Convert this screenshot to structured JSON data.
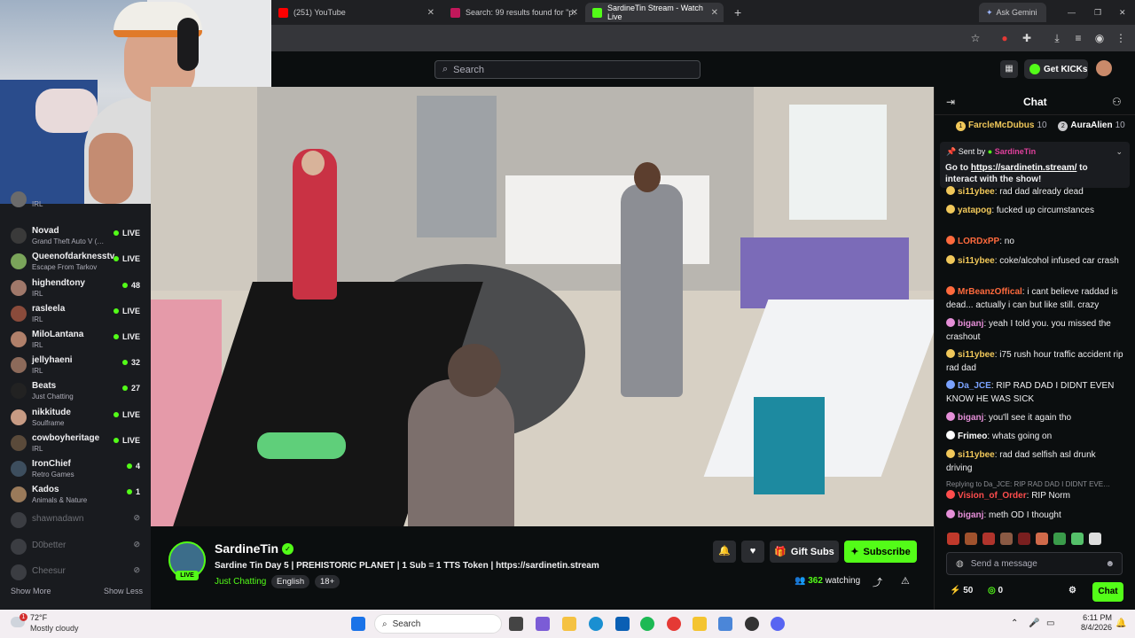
{
  "browser": {
    "tabs": [
      {
        "label": "(251) YouTube",
        "color": "#ff0000"
      },
      {
        "label": "Search: 99 results found for \"p…",
        "color": "#c2185b"
      },
      {
        "label": "SardineTin Stream - Watch Live",
        "color": "#53fc18"
      }
    ],
    "new_tab": "+",
    "ask_gemini": "Ask Gemini"
  },
  "site": {
    "search_placeholder": "Search",
    "get_kicks": "Get KICKs"
  },
  "sidebar": {
    "items": [
      {
        "name": "",
        "category": "IRL",
        "status": "",
        "live": false,
        "offline": false,
        "partial": true
      },
      {
        "name": "Novad",
        "category": "Grand Theft Auto V (…",
        "status": "LIVE",
        "live": true
      },
      {
        "name": "Queenofdarknesstv",
        "category": "Escape From Tarkov",
        "status": "LIVE",
        "live": true
      },
      {
        "name": "highendtony",
        "category": "IRL",
        "status": "48",
        "live": true
      },
      {
        "name": "rasleela",
        "category": "IRL",
        "status": "LIVE",
        "live": true
      },
      {
        "name": "MiloLantana",
        "category": "IRL",
        "status": "LIVE",
        "live": true
      },
      {
        "name": "jellyhaeni",
        "category": "IRL",
        "status": "32",
        "live": true
      },
      {
        "name": "Beats",
        "category": "Just Chatting",
        "status": "27",
        "live": true
      },
      {
        "name": "nikkitude",
        "category": "Soulframe",
        "status": "LIVE",
        "live": true
      },
      {
        "name": "cowboyheritage",
        "category": "IRL",
        "status": "LIVE",
        "live": true
      },
      {
        "name": "IronChief",
        "category": "Retro Games",
        "status": "4",
        "live": true
      },
      {
        "name": "Kados",
        "category": "Animals & Nature",
        "status": "1",
        "live": true
      },
      {
        "name": "shawnadawn",
        "category": "",
        "status": "",
        "live": false,
        "offline": true
      },
      {
        "name": "D0better",
        "category": "",
        "status": "",
        "live": false,
        "offline": true
      },
      {
        "name": "Cheesur",
        "category": "",
        "status": "",
        "live": false,
        "offline": true
      }
    ],
    "show_more": "Show More",
    "show_less": "Show Less"
  },
  "stream": {
    "channel": "SardineTin",
    "live_badge": "LIVE",
    "title": "Sardine Tin Day 5 | PREHISTORIC PLANET | 1 Sub = 1 TTS Token | https://sardinetin.stream",
    "category": "Just Chatting",
    "tags": [
      "English",
      "18+"
    ],
    "gift_subs": "Gift Subs",
    "subscribe": "Subscribe",
    "viewers": "362",
    "watching_label": "watching"
  },
  "chat": {
    "title": "Chat",
    "leaderboard": [
      {
        "rank": "1",
        "user": "FarcleMcDubus",
        "count": "10"
      },
      {
        "rank": "2",
        "user": "AuraAlien",
        "count": "10"
      }
    ],
    "pinned": {
      "sent_by_label": "Sent by",
      "sender": "SardineTin",
      "text_prefix": "Go to ",
      "link": "https://sardinetin.stream/",
      "text_suffix": " to interact with the show!"
    },
    "messages": [
      {
        "user": "si11ybee",
        "text": "rad dad already dead",
        "color": "#f1c85a"
      },
      {
        "user": "yatapog",
        "text": "fucked up circumstances",
        "color": "#f1c85a"
      },
      {
        "user": "LORDxPP",
        "text": "no",
        "color": "#ff6a3d"
      },
      {
        "user": "si11ybee",
        "text": "coke/alcohol infused car crash",
        "color": "#f1c85a"
      },
      {
        "user": "MrBeanzOffical",
        "text": "i cant believe raddad is dead... actually i can but like still. crazy",
        "color": "#ff6a3d"
      },
      {
        "user": "biganj",
        "text": "yeah I told you. you missed the crashout",
        "color": "#e58fd8"
      },
      {
        "user": "si11ybee",
        "text": "i75 rush hour traffic accident rip rad dad",
        "color": "#f1c85a"
      },
      {
        "user": "Da_JCE",
        "text": "RIP RAD DAD I DIDNT EVEN KNOW HE WAS SICK",
        "color": "#7aa2ff"
      },
      {
        "user": "biganj",
        "text": "you'll see it again tho",
        "color": "#e58fd8"
      },
      {
        "user": "Frimeo",
        "text": "whats going on",
        "color": "#ffffff"
      },
      {
        "user": "si11ybee",
        "text": "rad dad selfish asl drunk driving",
        "color": "#f1c85a"
      },
      {
        "user": "Vision_of_Order",
        "text": "RIP Norm",
        "color": "#ff4d4d"
      },
      {
        "user": "biganj",
        "text": "meth OD I thought",
        "color": "#e58fd8"
      }
    ],
    "reply_to": "Replying to Da_JCE: RIP RAD DAD I DIDNT EVE…",
    "input_placeholder": "Send a message",
    "kicks_count": "50",
    "points_count": "0",
    "chat_button": "Chat"
  },
  "taskbar": {
    "temperature": "72°F",
    "weather": "Mostly cloudy",
    "weather_badge": "1",
    "search_label": "Search",
    "time": "6:11 PM",
    "date": "8/4/2026"
  },
  "colors": {
    "accent": "#53fc18",
    "bg": "#0b0e0f",
    "sidebar_bg": "#191b1f"
  }
}
